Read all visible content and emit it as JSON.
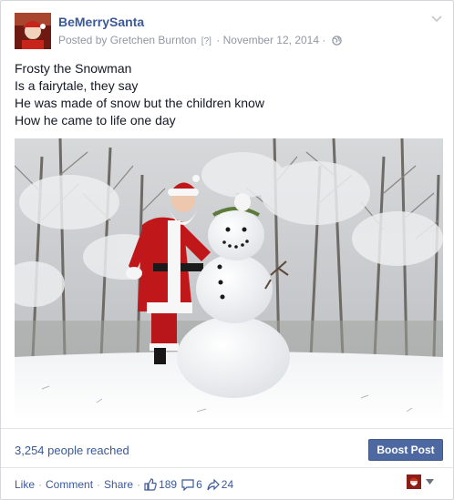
{
  "post": {
    "page_name": "BeMerrySanta",
    "posted_by_prefix": "Posted by",
    "author": "Gretchen Burnton",
    "author_marker": "[?]",
    "separator": "·",
    "date": "November 12, 2014",
    "lines": [
      "Frosty the Snowman",
      "Is a fairytale, they say",
      "He was made of snow but the children know",
      "How he came to life one day"
    ],
    "photo_icon": "santa-and-snowman-photo"
  },
  "insights": {
    "reach_text": "3,254 people reached",
    "boost_label": "Boost Post"
  },
  "actions": {
    "like": "Like",
    "comment": "Comment",
    "share": "Share",
    "separator": "·",
    "likes_count": "189",
    "comments_count": "6",
    "shares_count": "24"
  },
  "colors": {
    "link_blue": "#3b5998",
    "boost_blue": "#4e69a2",
    "meta_gray": "#9197a3"
  }
}
